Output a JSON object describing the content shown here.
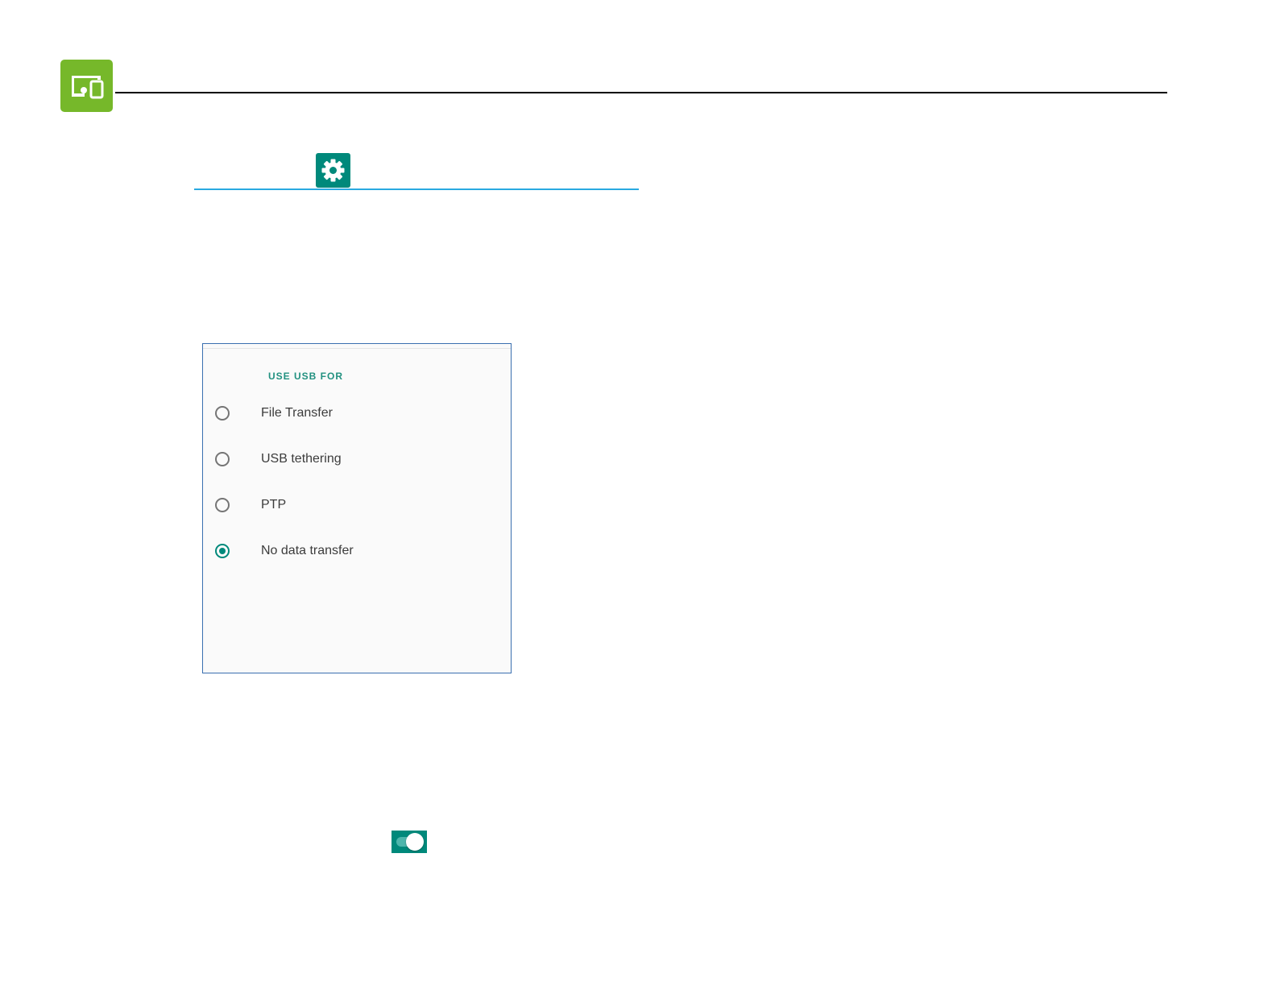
{
  "header": {
    "chapter_icon": "devices-icon",
    "accent_color": "#76b82a"
  },
  "settings_icon": {
    "icon": "gear-icon",
    "color": "#00897b"
  },
  "usb_dialog": {
    "heading": "USE USB FOR",
    "options": [
      {
        "label": "File Transfer",
        "selected": false
      },
      {
        "label": "USB tethering",
        "selected": false
      },
      {
        "label": "PTP",
        "selected": false
      },
      {
        "label": "No data transfer",
        "selected": true
      }
    ],
    "accent_color": "#00897b"
  },
  "toggle": {
    "state": "on",
    "color": "#00897b"
  }
}
